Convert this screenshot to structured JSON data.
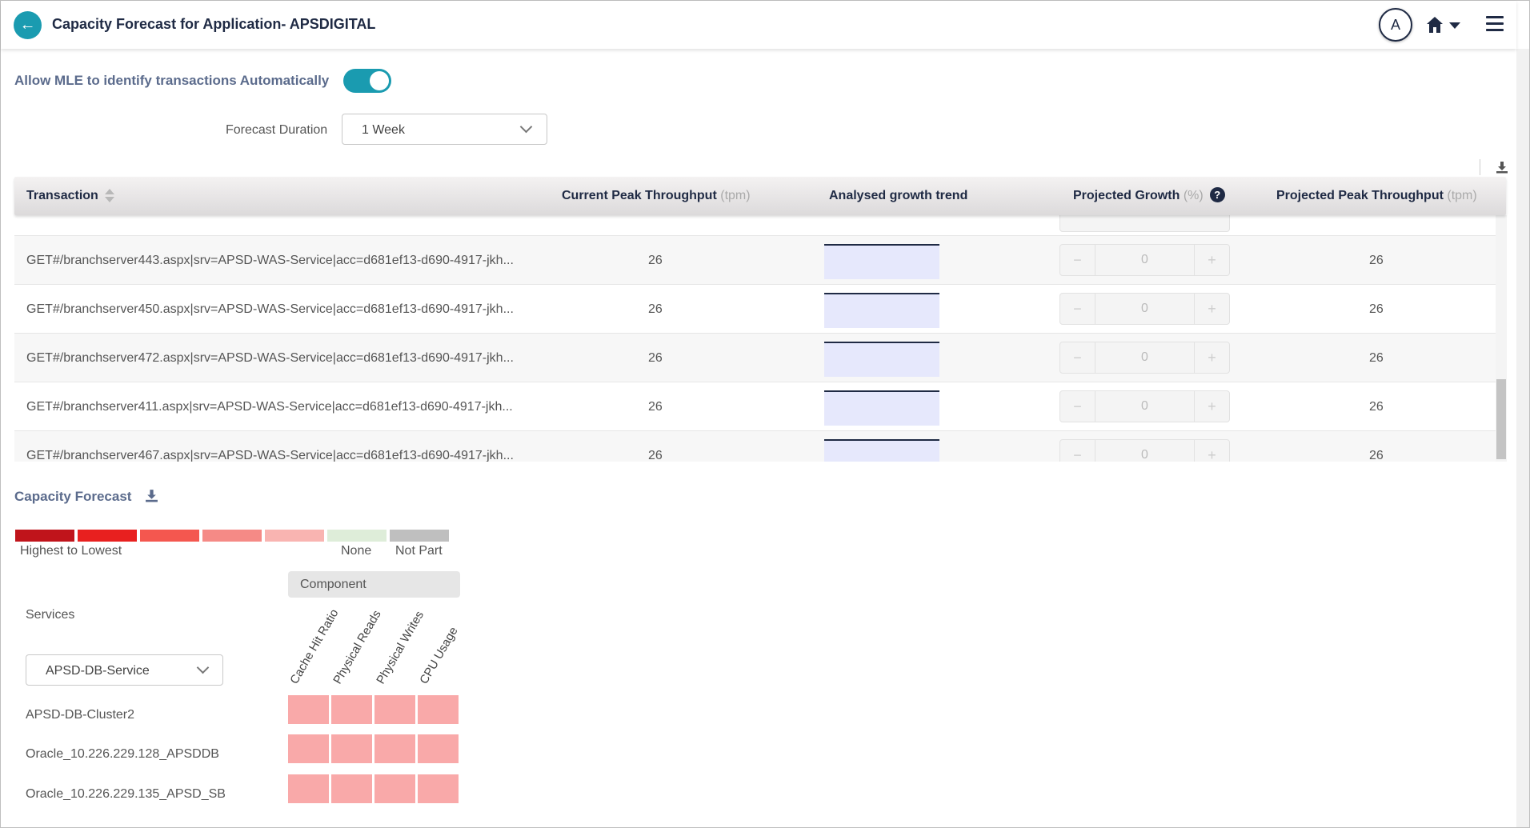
{
  "header": {
    "title": "Capacity Forecast for Application- APSDIGITAL",
    "avatar_letter": "A"
  },
  "settings": {
    "mle_label": "Allow MLE to identify transactions Automatically",
    "mle_enabled": true,
    "forecast_duration_label": "Forecast Duration",
    "forecast_duration_value": "1 Week"
  },
  "table": {
    "columns": {
      "transaction": "Transaction",
      "current_peak": "Current Peak Throughput",
      "current_peak_unit": "(tpm)",
      "trend": "Analysed growth trend",
      "projected_growth": "Projected Growth",
      "projected_growth_unit": "(%)",
      "projected_peak": "Projected Peak Throughput",
      "projected_peak_unit": "(tpm)"
    },
    "rows": [
      {
        "transaction": "GET#/branchserver443.aspx|srv=APSD-WAS-Service|acc=d681ef13-d690-4917-jkh...",
        "current_peak": "26",
        "growth": "0",
        "projected_peak": "26"
      },
      {
        "transaction": "GET#/branchserver450.aspx|srv=APSD-WAS-Service|acc=d681ef13-d690-4917-jkh...",
        "current_peak": "26",
        "growth": "0",
        "projected_peak": "26"
      },
      {
        "transaction": "GET#/branchserver472.aspx|srv=APSD-WAS-Service|acc=d681ef13-d690-4917-jkh...",
        "current_peak": "26",
        "growth": "0",
        "projected_peak": "26"
      },
      {
        "transaction": "GET#/branchserver411.aspx|srv=APSD-WAS-Service|acc=d681ef13-d690-4917-jkh...",
        "current_peak": "26",
        "growth": "0",
        "projected_peak": "26"
      },
      {
        "transaction": "GET#/branchserver467.aspx|srv=APSD-WAS-Service|acc=d681ef13-d690-4917-jkh...",
        "current_peak": "26",
        "growth": "0",
        "projected_peak": "26"
      }
    ],
    "stepper_minus": "−",
    "stepper_plus": "+"
  },
  "capacity_forecast": {
    "title": "Capacity Forecast",
    "legend": {
      "colors": [
        "#c0141b",
        "#e8201f",
        "#f4574f",
        "#f58a86",
        "#f9b4b1",
        "#deedd9",
        "#bfbfbf"
      ],
      "highest_to_lowest": "Highest to Lowest",
      "none": "None",
      "not_part": "Not Part"
    },
    "component_header": "Component",
    "services_label": "Services",
    "service_select": "APSD-DB-Service",
    "columns": [
      "Cache Hit Ratio",
      "Physical Reads",
      "Physical Writes",
      "CPU Usage"
    ],
    "services": [
      "APSD-DB-Cluster2",
      "Oracle_10.226.229.128_APSDDB",
      "Oracle_10.226.229.135_APSD_SB"
    ],
    "cell_color": "#f9a9a9"
  }
}
